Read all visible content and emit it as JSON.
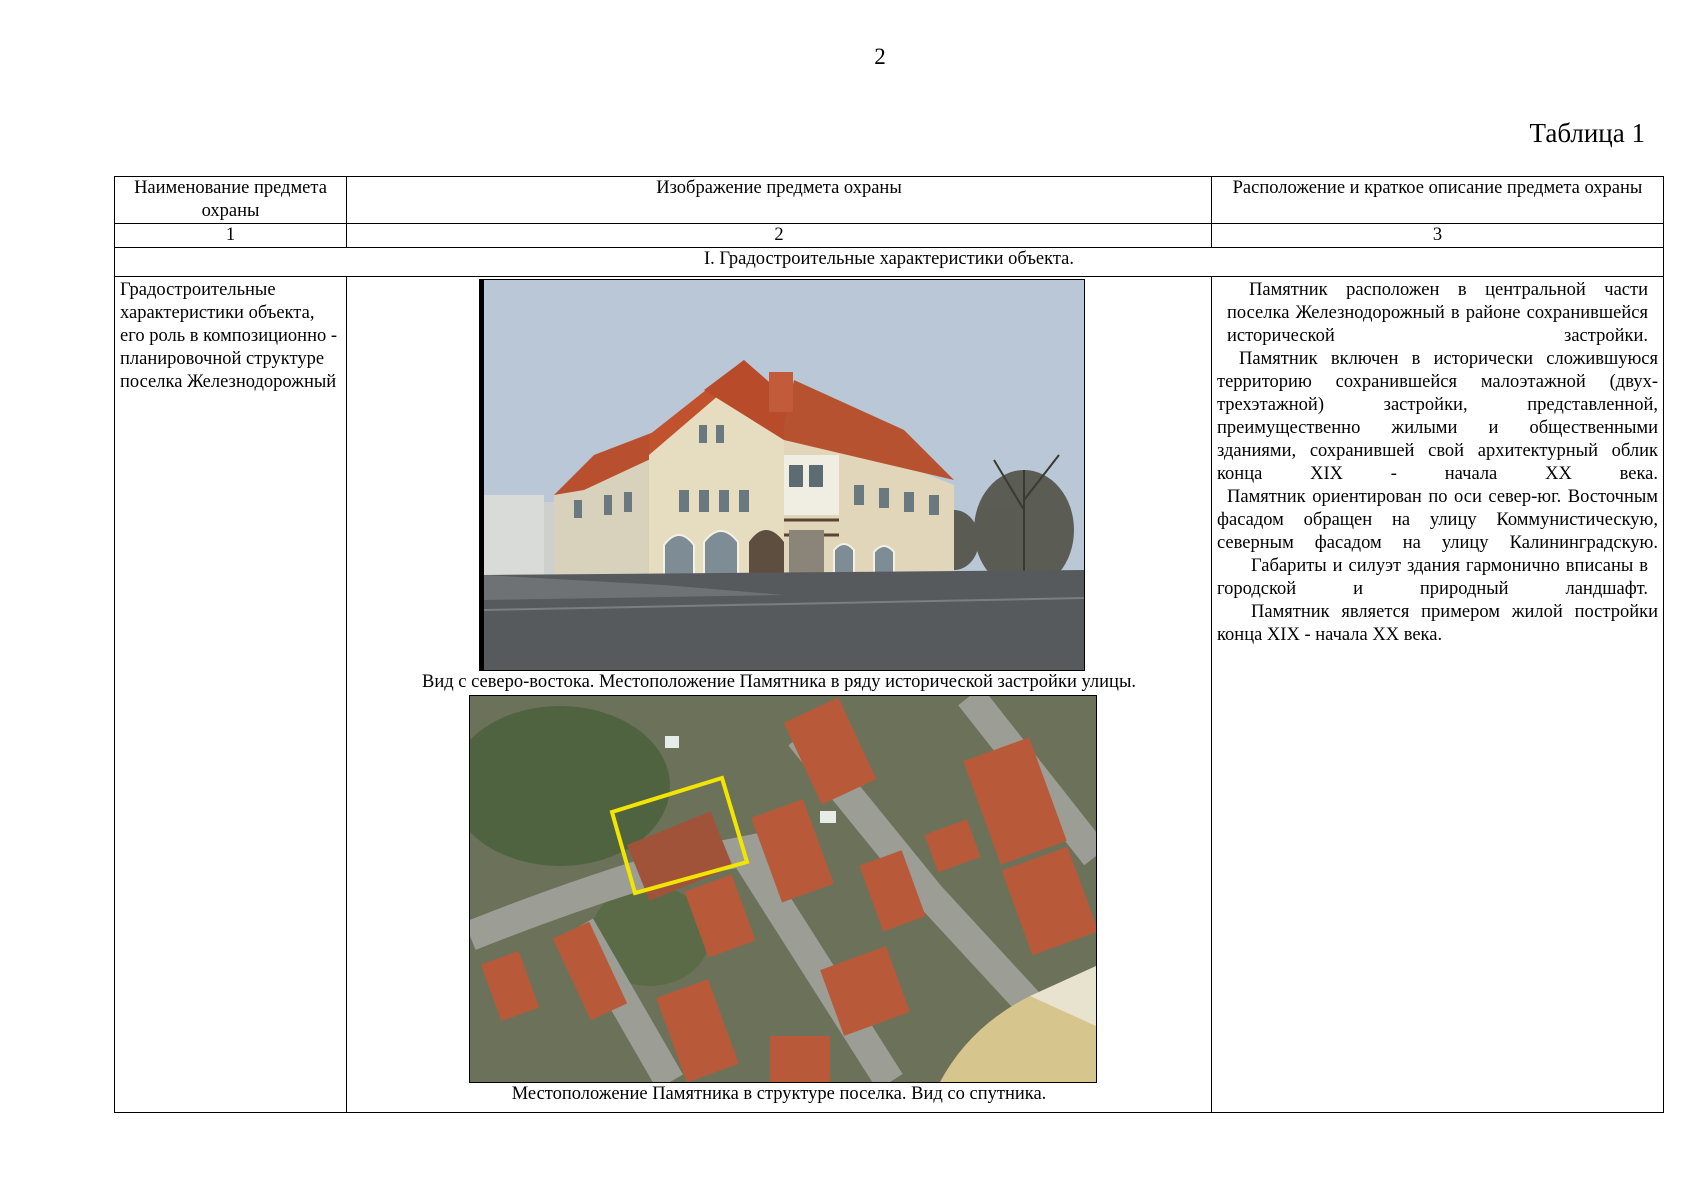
{
  "page_number": "2",
  "table_label": "Таблица 1",
  "table": {
    "headers": [
      "Наименование предмета охраны",
      "Изображение предмета охраны",
      "Расположение и краткое описание предмета охраны"
    ],
    "column_numbers": [
      "1",
      "2",
      "3"
    ],
    "section_title": "I. Градостроительные характеристики объекта.",
    "row": {
      "name": "Градостроительные характеристики объекта, его роль в композиционно - планировочной структуре поселка Железнодорожный",
      "photo_caption": "Вид с северо-востока. Местоположение Памятника в ряду исторической застройки улицы.",
      "satellite_caption": "Местоположение Памятника в структуре поселка. Вид со спутника.",
      "description": [
        "Памятник расположен в центральной части поселка Железнодорожный в районе сохранившейся исторической застройки.",
        "Памятник включен в исторически сложившуюся территорию сохранившейся малоэтажной (двух-трехэтажной) застройки, представленной, преимущественно жилыми и общественными зданиями, сохранившей свой архитектурный облик конца XIX - начала XX века.",
        "Памятник ориентирован по оси север-юг. Восточным фасадом обращен на улицу Коммунистическую, северным фасадом на улицу Калининградскую.",
        "Габариты и силуэт здания гармонично вписаны в городской и природный ландшафт.",
        "Памятник является примером жилой постройки конца XIX - начала XX века."
      ]
    }
  },
  "colors": {
    "highlight_outline": "#f2e600",
    "roof": "#c0532e",
    "facade": "#e6dcc0"
  }
}
